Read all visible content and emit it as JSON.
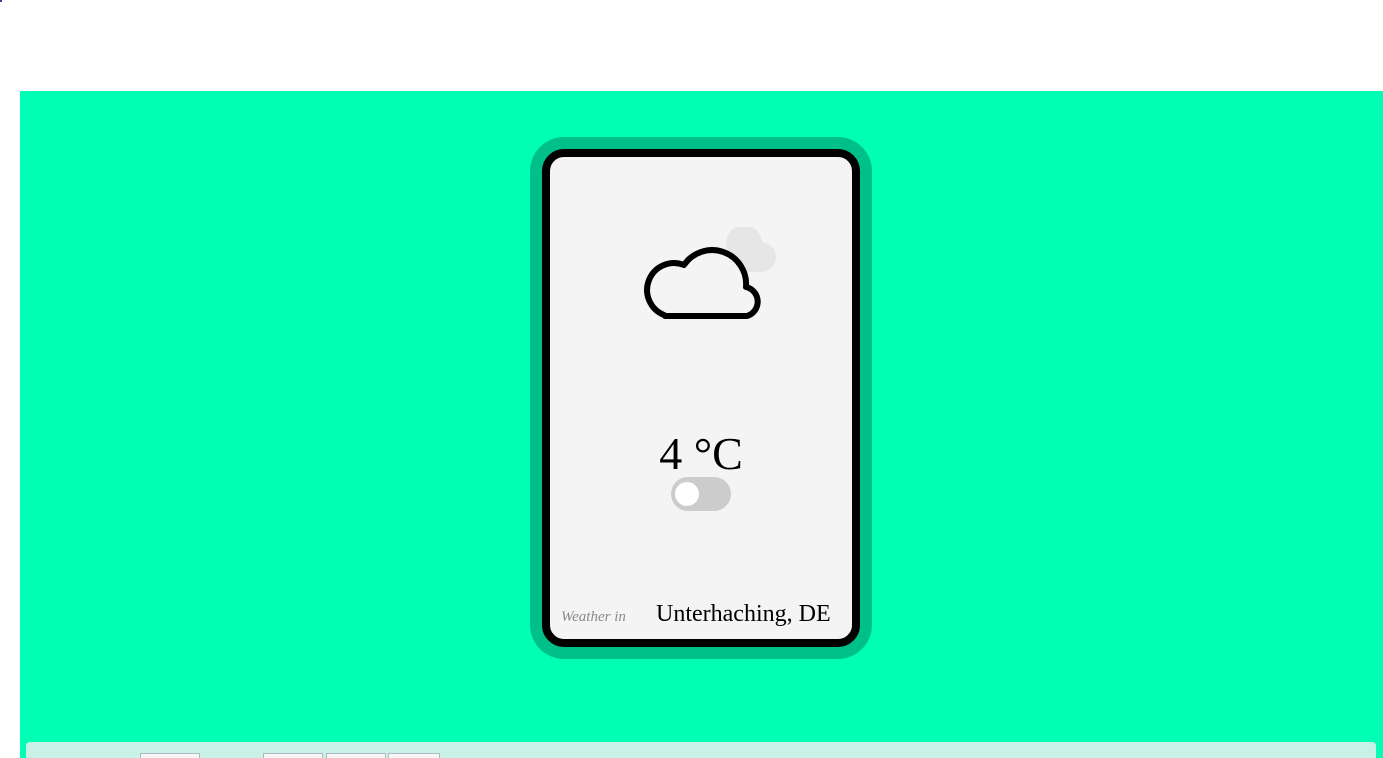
{
  "weather": {
    "temperature": "4 °C",
    "prefix": "Weather in",
    "location": "Unterhaching, DE",
    "unit_toggle_checked": false
  },
  "icons": {
    "main": "cloud-icon",
    "secondary": "cloud-icon"
  },
  "colors": {
    "background": "#00ffb4",
    "card_frame": "#00c08a",
    "card_border": "#000000",
    "card_fill": "#f4f4f4",
    "toggle_off": "#cccccc"
  }
}
